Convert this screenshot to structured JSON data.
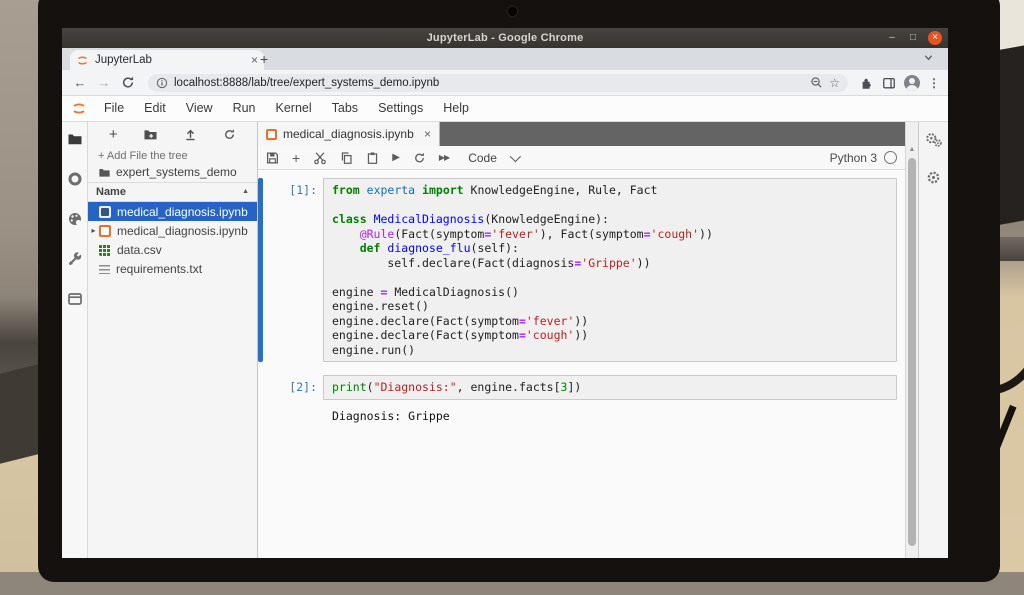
{
  "window": {
    "title": "JupyterLab - Google Chrome"
  },
  "browser": {
    "tab_title": "JupyterLab",
    "url": "localhost:8888/lab/tree/expert_systems_demo.ipynb",
    "new_tab_label": "+",
    "tab_close_label": "×"
  },
  "window_controls": {
    "minimize": "–",
    "maximize": "□",
    "close": "×"
  },
  "menubar": {
    "items": [
      "File",
      "Edit",
      "View",
      "Run",
      "Kernel",
      "Tabs",
      "Settings",
      "Help"
    ]
  },
  "filebrowser": {
    "add_file_label": "+ Add File the tree",
    "breadcrumb": "expert_systems_demo",
    "header": "Name",
    "sort_glyph": "▲",
    "files": [
      {
        "name": "medical_diagnosis.ipynb",
        "icon": "nb-sel",
        "selected": true,
        "caret": ""
      },
      {
        "name": "medical_diagnosis.ipynb",
        "icon": "nb",
        "selected": false,
        "caret": "▸"
      },
      {
        "name": "data.csv",
        "icon": "csv",
        "selected": false,
        "caret": ""
      },
      {
        "name": "requirements.txt",
        "icon": "txt",
        "selected": false,
        "caret": ""
      }
    ]
  },
  "notebook": {
    "tab_title": "medical_diagnosis.ipynb",
    "tab_close_label": "×",
    "toolbar": {
      "run_glyph": "▶",
      "ffwd_glyph": "▶▶",
      "cell_type": "Code",
      "kernel_name": "Python 3"
    },
    "cells": [
      {
        "prompt": "[1]:",
        "active": true,
        "lines": [
          [
            [
              "kw",
              "from"
            ],
            [
              "pl",
              " "
            ],
            [
              "mod",
              "experta"
            ],
            [
              "pl",
              " "
            ],
            [
              "kw",
              "import"
            ],
            [
              "pl",
              " KnowledgeEngine, Rule, Fact"
            ]
          ],
          [],
          [
            [
              "kw",
              "class"
            ],
            [
              "pl",
              " "
            ],
            [
              "def",
              "MedicalDiagnosis"
            ],
            [
              "pl",
              "(KnowledgeEngine):"
            ]
          ],
          [
            [
              "pl",
              "    "
            ],
            [
              "meta",
              "@Rule"
            ],
            [
              "pl",
              "(Fact(symptom"
            ],
            [
              "op",
              "="
            ],
            [
              "str",
              "'fever'"
            ],
            [
              "pl",
              "), Fact(symptom"
            ],
            [
              "op",
              "="
            ],
            [
              "str",
              "'cough'"
            ],
            [
              "pl",
              "))"
            ]
          ],
          [
            [
              "pl",
              "    "
            ],
            [
              "kw",
              "def"
            ],
            [
              "pl",
              " "
            ],
            [
              "def",
              "diagnose_flu"
            ],
            [
              "pl",
              "(self):"
            ]
          ],
          [
            [
              "pl",
              "        self.declare(Fact(diagnosis"
            ],
            [
              "op",
              "="
            ],
            [
              "str",
              "'Grippe'"
            ],
            [
              "pl",
              "))"
            ]
          ],
          [],
          [
            [
              "pl",
              "engine "
            ],
            [
              "op",
              "="
            ],
            [
              "pl",
              " MedicalDiagnosis()"
            ]
          ],
          [
            [
              "pl",
              "engine.reset()"
            ]
          ],
          [
            [
              "pl",
              "engine.declare(Fact(symptom"
            ],
            [
              "op",
              "="
            ],
            [
              "str",
              "'fever'"
            ],
            [
              "pl",
              "))"
            ]
          ],
          [
            [
              "pl",
              "engine.declare(Fact(symptom"
            ],
            [
              "op",
              "="
            ],
            [
              "str",
              "'cough'"
            ],
            [
              "pl",
              "))"
            ]
          ],
          [
            [
              "pl",
              "engine.run()"
            ]
          ]
        ],
        "output": null
      },
      {
        "prompt": "[2]:",
        "active": false,
        "lines": [
          [
            [
              "bi",
              "print"
            ],
            [
              "pl",
              "("
            ],
            [
              "str",
              "\"Diagnosis:\""
            ],
            [
              "pl",
              ", engine.facts["
            ],
            [
              "num",
              "3"
            ],
            [
              "pl",
              "])"
            ]
          ]
        ],
        "output": "Diagnosis: Grippe"
      }
    ]
  },
  "colors": {
    "jupyter_orange": "#f37626",
    "selection_blue": "#2563c4",
    "active_cell_bar": "#2371c8",
    "ubuntu_close": "#e9541f",
    "keyword_green": "#008000",
    "string_red": "#ba2121",
    "operator_purple": "#aa22ff"
  }
}
